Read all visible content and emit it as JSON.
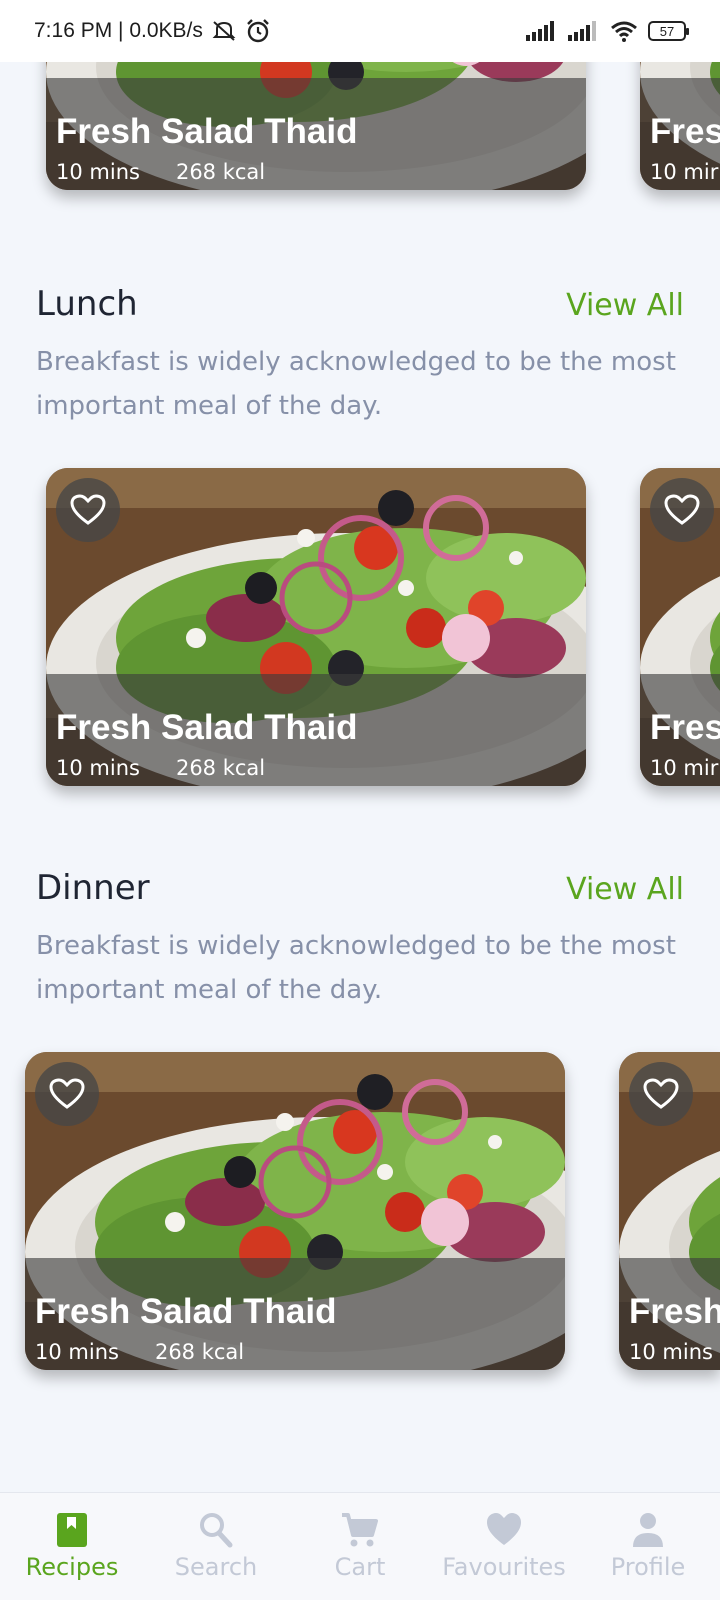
{
  "status_bar": {
    "time_speed": "7:16 PM | 0.0KB/s",
    "battery": "57"
  },
  "sections": [
    {
      "title": "Lunch",
      "view_all": "View All",
      "description": "Breakfast is widely acknowledged to be the most important meal of the day."
    },
    {
      "title": "Dinner",
      "view_all": "View All",
      "description": "Breakfast is widely acknowledged to be the most important meal of the day."
    }
  ],
  "cards": {
    "top_partial": {
      "title": "Fresh Salad Thaid",
      "time": "10 mins",
      "calories": "268 kcal",
      "peek_title": "Fres",
      "peek_time": "10 mir"
    },
    "lunch": {
      "title": "Fresh Salad Thaid",
      "time": "10 mins",
      "calories": "268 kcal",
      "peek_title": "Fres",
      "peek_time": "10 mir"
    },
    "dinner": {
      "title": "Fresh Salad Thaid",
      "time": "10 mins",
      "calories": "268 kcal",
      "peek_title": "Fresh",
      "peek_time": "10 mins"
    }
  },
  "nav": [
    {
      "label": "Recipes",
      "icon": "book-icon",
      "active": true
    },
    {
      "label": "Search",
      "icon": "search-icon",
      "active": false
    },
    {
      "label": "Cart",
      "icon": "cart-icon",
      "active": false
    },
    {
      "label": "Favourites",
      "icon": "heart-icon",
      "active": false
    },
    {
      "label": "Profile",
      "icon": "person-icon",
      "active": false
    }
  ],
  "colors": {
    "accent": "#5aa51e",
    "background": "#f3f6fb",
    "inactive": "#c3c9d6"
  }
}
